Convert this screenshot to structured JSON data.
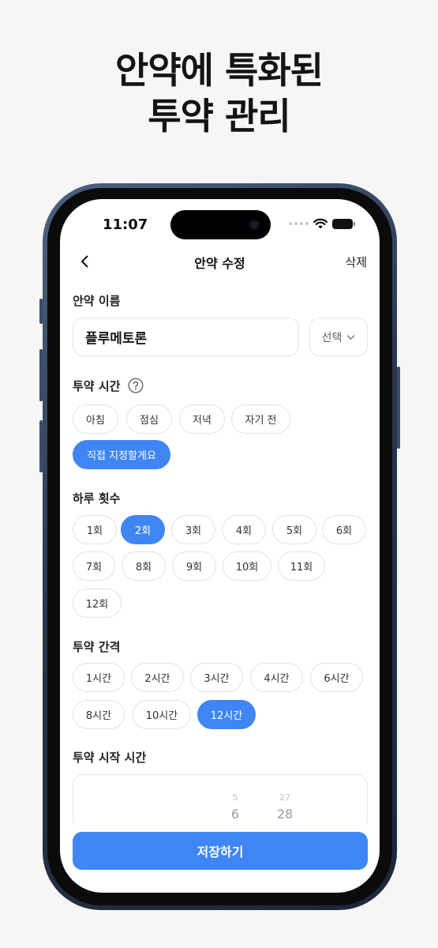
{
  "headline": {
    "line1": "안약에 특화된",
    "line2": "투약 관리"
  },
  "status_bar": {
    "time": "11:07"
  },
  "nav": {
    "title": "안약 수정",
    "delete_label": "삭제"
  },
  "name_section": {
    "label": "안약 이름",
    "value": "플루메토론",
    "select_label": "선택"
  },
  "time_section": {
    "label": "투약 시간",
    "options": [
      "아침",
      "점심",
      "저녁",
      "자기 전",
      "직접 지정할게요"
    ],
    "selected": "직접 지정할게요"
  },
  "count_section": {
    "label": "하루 횟수",
    "options": [
      "1회",
      "2회",
      "3회",
      "4회",
      "5회",
      "6회",
      "7회",
      "8회",
      "9회",
      "10회",
      "11회",
      "12회"
    ],
    "selected": "2회"
  },
  "interval_section": {
    "label": "투약 간격",
    "options": [
      "1시간",
      "2시간",
      "3시간",
      "4시간",
      "6시간",
      "8시간",
      "10시간",
      "12시간"
    ],
    "selected": "12시간"
  },
  "start_section": {
    "label": "투약 시작 시간",
    "picker": {
      "hour_prev": "5",
      "hour": "6",
      "minute_prev": "27",
      "minute": "28"
    }
  },
  "save_button": {
    "label": "저장하기"
  },
  "colors": {
    "accent": "#3f86f4",
    "frame": "#2a3a52",
    "background": "#f6f6f6"
  }
}
